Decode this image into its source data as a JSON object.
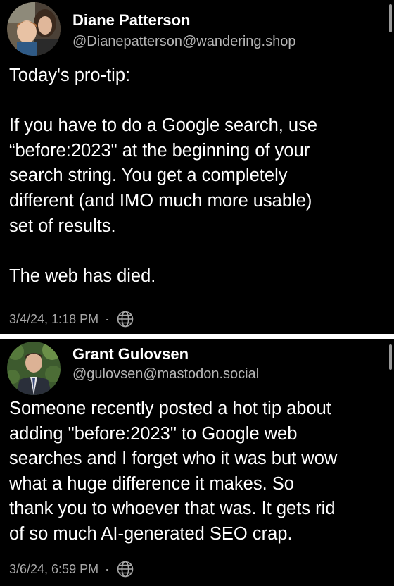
{
  "posts": [
    {
      "display_name": "Diane Patterson",
      "handle": "@Dianepatterson@wandering.shop",
      "avatar_icon": "avatar-photo-woman-with-child",
      "lines": [
        "Today's pro-tip:",
        "",
        "If you have to do a Google search, use",
        "“before:2023\" at the beginning of your",
        "search string. You get a completely",
        "different (and IMO much more usable)",
        "set of results.",
        "",
        "The web has died."
      ],
      "timestamp": "3/4/24, 1:18 PM",
      "separator": "·",
      "visibility_icon": "globe-icon"
    },
    {
      "display_name": "Grant Gulovsen",
      "handle": "@gulovsen@mastodon.social",
      "avatar_icon": "avatar-photo-man-in-suit",
      "lines": [
        "Someone recently posted a hot tip about",
        "adding \"before:2023\" to Google web",
        "searches and I forget who it was but wow",
        "what a huge difference it makes. So",
        "thank you to whoever that was. It gets rid",
        "of so much AI-generated SEO crap."
      ],
      "timestamp": "3/6/24, 6:59 PM",
      "separator": "·",
      "visibility_icon": "globe-icon"
    }
  ],
  "colors": {
    "background": "#000000",
    "text": "#ffffff",
    "handle": "#b5b5b5",
    "meta": "#a8a8a8",
    "divider": "#ffffff"
  }
}
